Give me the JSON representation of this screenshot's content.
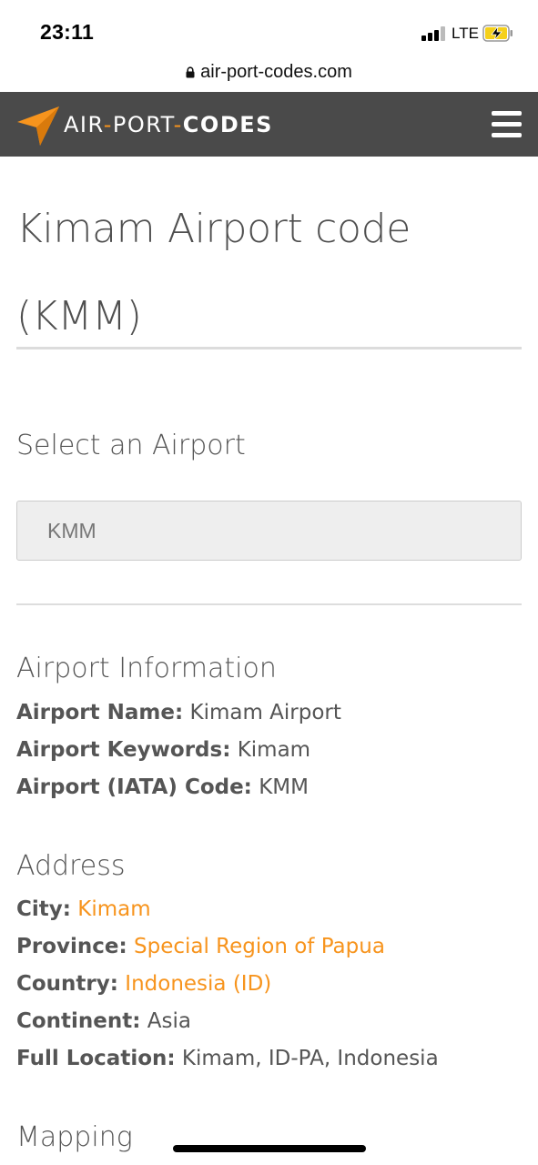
{
  "status_bar": {
    "time": "23:11",
    "network": "LTE",
    "icons": [
      "signal-icon",
      "battery-charging-icon"
    ]
  },
  "browser": {
    "url": "air-port-codes.com",
    "icons": [
      "lock-icon"
    ]
  },
  "header": {
    "logo_part1": "AIR",
    "logo_dash1": "-",
    "logo_part2": "PORT",
    "logo_dash2": "-",
    "logo_part3": "CODES",
    "icons": [
      "paper-plane-logo-icon",
      "hamburger-menu-icon"
    ],
    "brand_color": "#f7941d",
    "header_bg": "#4a4a4a"
  },
  "main": {
    "title_line1": "Kimam Airport code",
    "title_line2": "(KMM)",
    "select_heading": "Select an Airport",
    "select_value": "KMM",
    "airport_info": {
      "heading": "Airport Information",
      "name_label": "Airport Name:",
      "name_value": "Kimam Airport",
      "keywords_label": "Airport Keywords:",
      "keywords_value": "Kimam",
      "code_label": "Airport (IATA) Code:",
      "code_value": "KMM"
    },
    "address": {
      "heading": "Address",
      "city_label": "City:",
      "city_value": "Kimam",
      "province_label": "Province:",
      "province_value": "Special Region of Papua",
      "country_label": "Country:",
      "country_value": "Indonesia (ID)",
      "continent_label": "Continent:",
      "continent_value": "Asia",
      "full_label": "Full Location:",
      "full_value": "Kimam, ID-PA, Indonesia"
    },
    "mapping_heading": "Mapping"
  }
}
